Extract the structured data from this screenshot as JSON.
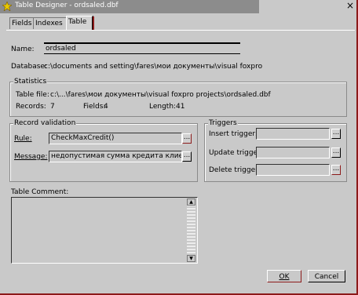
{
  "window": {
    "title": "Table Designer - ordsaled.dbf",
    "close": "×"
  },
  "tabs": [
    {
      "label": "Fields"
    },
    {
      "label": "Indexes"
    },
    {
      "label": "Table"
    }
  ],
  "table": {
    "name_label": "Name:",
    "name_value": "ordsaled",
    "database_label": "Database:",
    "database_value": "c:\\documents and setting\\fares\\мои документы\\visual foxpro"
  },
  "statistics": {
    "title": "Statistics",
    "table_file_label": "Table file:",
    "table_file_value": "c:\\...\\fares\\мои документы\\visual foxpro projects\\ordsaled.dbf",
    "records_label": "Records:",
    "records_value": "7",
    "fields_label": "Fields:",
    "fields_value": "4",
    "length_label": "Length:",
    "length_value": "41"
  },
  "record_validation": {
    "title": "Record validation",
    "rule_label": "Rule:",
    "rule_value": "CheckMaxCredit()",
    "message_label": "Message:",
    "message_value": "недопустимая сумма кредита клиента"
  },
  "triggers": {
    "title": "Triggers",
    "insert_label": "Insert trigger:",
    "update_label": "Update trigger:",
    "delete_label": "Delete trigger:",
    "insert_value": "",
    "update_value": "",
    "delete_value": ""
  },
  "comment": {
    "label": "Table Comment:",
    "value": ""
  },
  "buttons": {
    "ellipsis": "...",
    "ok": "OK",
    "cancel": "Cancel"
  },
  "icons": {
    "title_logo": "visual-foxpro-logo-icon",
    "scroll_up": "arrow-up-icon",
    "scroll_down": "arrow-down-icon"
  }
}
